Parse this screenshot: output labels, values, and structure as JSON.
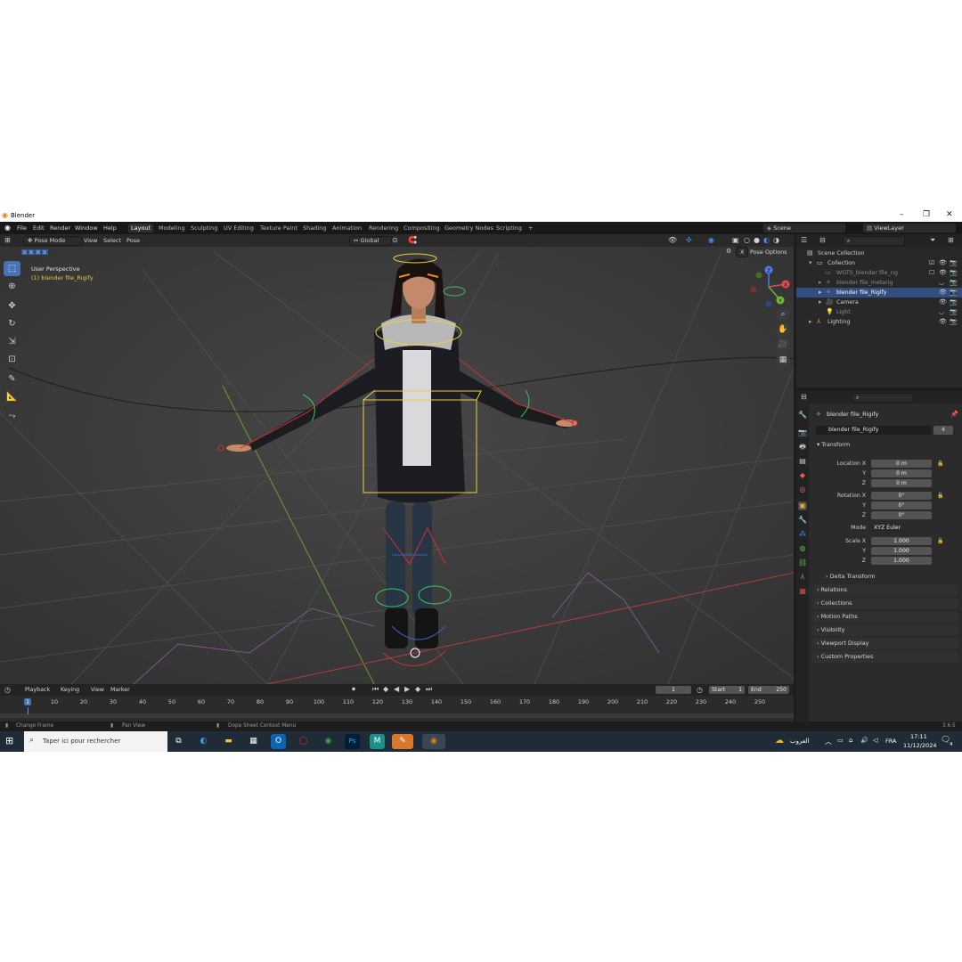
{
  "window": {
    "title": "Blender",
    "controls": {
      "minimize": "–",
      "maximize": "❐",
      "close": "✕"
    }
  },
  "menu": [
    "File",
    "Edit",
    "Render",
    "Window",
    "Help"
  ],
  "workspaces": [
    "Layout",
    "Modeling",
    "Sculpting",
    "UV Editing",
    "Texture Paint",
    "Shading",
    "Animation",
    "Rendering",
    "Compositing",
    "Geometry Nodes",
    "Scripting"
  ],
  "active_workspace": "Layout",
  "add_workspace": "+",
  "scene": {
    "label": "Scene",
    "view_layer": "ViewLayer"
  },
  "viewport": {
    "mode": "Pose Mode",
    "menus": [
      "View",
      "Select",
      "Pose"
    ],
    "orientation": "Global",
    "perspective": "User Perspective",
    "object_info": "(1) blender file_Rigify",
    "pose_options": "Pose Options",
    "x_label": "X",
    "gizmo_axes": {
      "x": "X",
      "y": "Y",
      "z": "Z"
    },
    "colors": {
      "background": "#3d3d3d",
      "selected_text": "#e8c74a",
      "bone_red": "#d03030",
      "bone_yellow": "#e8d040",
      "bone_green": "#40c060"
    }
  },
  "outliner": {
    "search_placeholder": "",
    "rows": [
      {
        "label": "Scene Collection",
        "indent": 0,
        "selected": false,
        "dim": false
      },
      {
        "label": "Collection",
        "indent": 1,
        "selected": false,
        "dim": false
      },
      {
        "label": "WGTS_blender file_rig",
        "indent": 2,
        "selected": false,
        "dim": true
      },
      {
        "label": "blender file_metarig",
        "indent": 2,
        "selected": false,
        "dim": true
      },
      {
        "label": "blender file_Rigify",
        "indent": 2,
        "selected": true,
        "dim": false
      },
      {
        "label": "Camera",
        "indent": 2,
        "selected": false,
        "dim": false
      },
      {
        "label": "Light",
        "indent": 2,
        "selected": false,
        "dim": true
      },
      {
        "label": "Lighting",
        "indent": 1,
        "selected": false,
        "dim": false
      }
    ]
  },
  "properties": {
    "object_name": "blender file_Rigify",
    "data_name": "blender file_Rigify",
    "users": "4",
    "transform_header": "Transform",
    "location": {
      "label": "Location X",
      "y": "Y",
      "z": "Z",
      "values": [
        "0 m",
        "0 m",
        "0 m"
      ]
    },
    "rotation": {
      "label": "Rotation X",
      "y": "Y",
      "z": "Z",
      "values": [
        "0°",
        "0°",
        "0°"
      ]
    },
    "mode": {
      "label": "Mode",
      "value": "XYZ Euler"
    },
    "scale": {
      "label": "Scale X",
      "y": "Y",
      "z": "Z",
      "values": [
        "1.000",
        "1.000",
        "1.000"
      ]
    },
    "delta_transform": "Delta Transform",
    "sections": [
      "Relations",
      "Collections",
      "Motion Paths",
      "Visibility",
      "Viewport Display",
      "Custom Properties"
    ]
  },
  "timeline": {
    "menus": [
      "Playback",
      "Keying",
      "View",
      "Marker"
    ],
    "current_frame": "1",
    "start_label": "Start",
    "start": "1",
    "end_label": "End",
    "end": "250",
    "ruler": [
      "1",
      "10",
      "20",
      "30",
      "40",
      "50",
      "60",
      "70",
      "80",
      "90",
      "100",
      "110",
      "120",
      "130",
      "140",
      "150",
      "160",
      "170",
      "180",
      "190",
      "200",
      "210",
      "220",
      "230",
      "240",
      "250"
    ]
  },
  "statusbar": {
    "left": "Change Frame",
    "middle": "Pan View",
    "right": "Dope Sheet Context Menu",
    "version": "3.6.5"
  },
  "taskbar": {
    "search_placeholder": "Taper ici pour rechercher",
    "weather": "الغروب",
    "lang": "FRA",
    "time": "17:11",
    "date": "11/12/2024",
    "notifications": "4"
  }
}
